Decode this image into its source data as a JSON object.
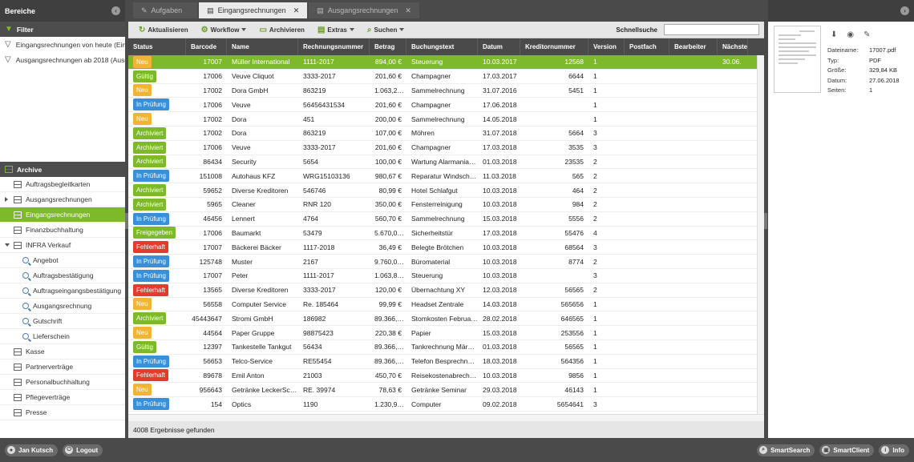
{
  "colors": {
    "accent": "#7db928",
    "neu": "#f0b532",
    "gueltig": "#7db928",
    "pruefung": "#3a8fd9",
    "archiviert": "#7db928",
    "fehlerhaft": "#e33b2c",
    "freigegeben": "#7db928"
  },
  "left": {
    "title": "Bereiche",
    "filter_title": "Filter",
    "filters": [
      "Eingangsrechnungen von heute (Eing",
      "Ausgangsrechnungen ab 2018 (Ausg"
    ],
    "archive_title": "Archive",
    "items": [
      {
        "label": "Auftragsbegleitkarten",
        "level": 0,
        "icon": "folder",
        "expand": ""
      },
      {
        "label": "Ausgangsrechnungen",
        "level": 0,
        "icon": "folder",
        "expand": "right"
      },
      {
        "label": "Eingangsrechnungen",
        "level": 0,
        "icon": "folder",
        "expand": "",
        "selected": true
      },
      {
        "label": "Finanzbuchhaltung",
        "level": 0,
        "icon": "folder",
        "expand": ""
      },
      {
        "label": "INFRA Verkauf",
        "level": 0,
        "icon": "folder",
        "expand": "down"
      },
      {
        "label": "Angebot",
        "level": 1,
        "icon": "search",
        "expand": ""
      },
      {
        "label": "Auftragsbestätigung",
        "level": 1,
        "icon": "search",
        "expand": ""
      },
      {
        "label": "Auftragseingangsbestätigung",
        "level": 1,
        "icon": "search",
        "expand": ""
      },
      {
        "label": "Ausgangsrechnung",
        "level": 1,
        "icon": "search",
        "expand": ""
      },
      {
        "label": "Gutschrift",
        "level": 1,
        "icon": "search",
        "expand": ""
      },
      {
        "label": "Lieferschein",
        "level": 1,
        "icon": "search",
        "expand": ""
      },
      {
        "label": "Kasse",
        "level": 0,
        "icon": "folder",
        "expand": ""
      },
      {
        "label": "Partnerverträge",
        "level": 0,
        "icon": "folder",
        "expand": ""
      },
      {
        "label": "Personalbuchhaltung",
        "level": 0,
        "icon": "folder",
        "expand": ""
      },
      {
        "label": "Pflegeverträge",
        "level": 0,
        "icon": "folder",
        "expand": ""
      },
      {
        "label": "Presse",
        "level": 0,
        "icon": "folder",
        "expand": ""
      }
    ]
  },
  "tabs": [
    {
      "label": "Aufgaben",
      "active": false,
      "close": ""
    },
    {
      "label": "Eingangsrechnungen",
      "active": true,
      "close": "✕"
    },
    {
      "label": "Ausgangsrechnungen",
      "active": false,
      "close": "✕"
    }
  ],
  "toolbar": {
    "refresh": "Aktualisieren",
    "workflow": "Workflow",
    "archive": "Archivieren",
    "extras": "Extras",
    "search": "Suchen",
    "quicksearch": "Schnellsuche"
  },
  "columns": [
    "Status",
    "Barcode",
    "Name",
    "Rechnungsnummer",
    "Betrag",
    "Buchungstext",
    "Datum",
    "Kreditornummer",
    "Version",
    "Postfach",
    "Bearbeiter",
    "Nächster"
  ],
  "rows": [
    [
      "Neu",
      "17007",
      "Müller International",
      "1111-2017",
      "894,00 €",
      "Steuerung",
      "10.03.2017",
      "12568",
      "1",
      "",
      "",
      "30.06."
    ],
    [
      "Gültig",
      "17006",
      "Veuve Cliquot",
      "3333-2017",
      "201,60 €",
      "Champagner",
      "17.03.2017",
      "6644",
      "1",
      "",
      "",
      ""
    ],
    [
      "Neu",
      "17002",
      "Dora GmbH",
      "863219",
      "1.063,2…",
      "Sammelrechnung",
      "31.07.2016",
      "5451",
      "1",
      "",
      "",
      ""
    ],
    [
      "In Prüfung",
      "17006",
      "Veuve",
      "56456431534",
      "201,60 €",
      "Champagner",
      "17.06.2018",
      "",
      "1",
      "",
      "",
      ""
    ],
    [
      "Neu",
      "17002",
      "Dora",
      "451",
      "200,00 €",
      "Sammelrechnung",
      "14.05.2018",
      "",
      "1",
      "",
      "",
      ""
    ],
    [
      "Archiviert",
      "17002",
      "Dora",
      "863219",
      "107,00 €",
      "Möhren",
      "31.07.2018",
      "5664",
      "3",
      "",
      "",
      ""
    ],
    [
      "Archiviert",
      "17006",
      "Veuve",
      "3333-2017",
      "201,60 €",
      "Champagner",
      "17.03.2018",
      "3535",
      "3",
      "",
      "",
      ""
    ],
    [
      "Archiviert",
      "86434",
      "Security",
      "5654",
      "100,00 €",
      "Wartung Alarmania…",
      "01.03.2018",
      "23535",
      "2",
      "",
      "",
      ""
    ],
    [
      "In Prüfung",
      "151008",
      "Autohaus KFZ",
      "WRG15103136",
      "980,67 €",
      "Reparatur Windsch…",
      "11.03.2018",
      "565",
      "2",
      "",
      "",
      ""
    ],
    [
      "Archiviert",
      "59652",
      "Diverse Kreditoren",
      "546746",
      "80,99 €",
      "Hotel Schlafgut",
      "10.03.2018",
      "464",
      "2",
      "",
      "",
      ""
    ],
    [
      "Archiviert",
      "5965",
      "Cleaner",
      "RNR 120",
      "350,00 €",
      "Fensterreinigung",
      "10.03.2018",
      "984",
      "2",
      "",
      "",
      ""
    ],
    [
      "In Prüfung",
      "46456",
      "Lennert",
      "4764",
      "560,70 €",
      "Sammelrechnung",
      "15.03.2018",
      "5556",
      "2",
      "",
      "",
      ""
    ],
    [
      "Freigegeben",
      "17006",
      "Baumarkt",
      "53479",
      "5.670,0…",
      "Sicherheitstür",
      "17.03.2018",
      "55476",
      "4",
      "",
      "",
      ""
    ],
    [
      "Fehlerhaft",
      "17007",
      "Bäckerei Bäcker",
      "1117-2018",
      "36,49 €",
      "Belegte Brötchen",
      "10.03.2018",
      "68564",
      "3",
      "",
      "",
      ""
    ],
    [
      "In Prüfung",
      "125748",
      "Muster",
      "2167",
      "9.760,0…",
      "Büromaterial",
      "10.03.2018",
      "8774",
      "2",
      "",
      "",
      ""
    ],
    [
      "In Prüfung",
      "17007",
      "Peter",
      "1111-2017",
      "1.063,8…",
      "Steuerung",
      "10.03.2018",
      "",
      "3",
      "",
      "",
      ""
    ],
    [
      "Fehlerhaft",
      "13565",
      "Diverse Kreditoren",
      "3333-2017",
      "120,00 €",
      "Übernachtung XY",
      "12.03.2018",
      "56565",
      "2",
      "",
      "",
      ""
    ],
    [
      "Neu",
      "56558",
      "Computer Service",
      "Re. 185464",
      "99,99 €",
      "Headset Zentrale",
      "14.03.2018",
      "565656",
      "1",
      "",
      "",
      ""
    ],
    [
      "Archiviert",
      "45443647",
      "Stromi GmbH",
      "186982",
      "89.366,…",
      "Stomkosten Februa…",
      "28.02.2018",
      "646565",
      "1",
      "",
      "",
      ""
    ],
    [
      "Neu",
      "44564",
      "Paper Gruppe",
      "98875423",
      "220,38 €",
      "Papier",
      "15.03.2018",
      "253556",
      "1",
      "",
      "",
      ""
    ],
    [
      "Gültig",
      "12397",
      "Tankestelle Tankgut",
      "56434",
      "89.366,…",
      "Tankrechnung Mär…",
      "01.03.2018",
      "56565",
      "1",
      "",
      "",
      ""
    ],
    [
      "In Prüfung",
      "56653",
      "Telco-Service",
      "RE55454",
      "89.366,…",
      "Telefon Besprechn…",
      "18.03.2018",
      "564356",
      "1",
      "",
      "",
      ""
    ],
    [
      "Fehlerhaft",
      "89678",
      "Emil Anton",
      "21003",
      "450,70 €",
      "Reisekostenabrech…",
      "10.03.2018",
      "9856",
      "1",
      "",
      "",
      ""
    ],
    [
      "Neu",
      "956643",
      "Getränke LeckerSc…",
      "RE. 39974",
      "78,63 €",
      "Getränke Seminar",
      "29.03.2018",
      "46143",
      "1",
      "",
      "",
      ""
    ],
    [
      "In Prüfung",
      "154",
      "Optics",
      "1190",
      "1.230,9…",
      "Computer",
      "09.02.2018",
      "5654641",
      "3",
      "",
      "",
      ""
    ]
  ],
  "result_count": "4008 Ergebnisse gefunden",
  "details": {
    "Dateiname:": "17007.pdf",
    "Typ:": "PDF",
    "Größe:": "329,84 KB",
    "Datum:": "27.06.2018",
    "Seiten:": "1"
  },
  "bottom": {
    "user": "Jan Kutsch",
    "logout": "Logout",
    "smartsearch": "SmartSearch",
    "smartclient": "SmartClient",
    "info": "Info"
  }
}
